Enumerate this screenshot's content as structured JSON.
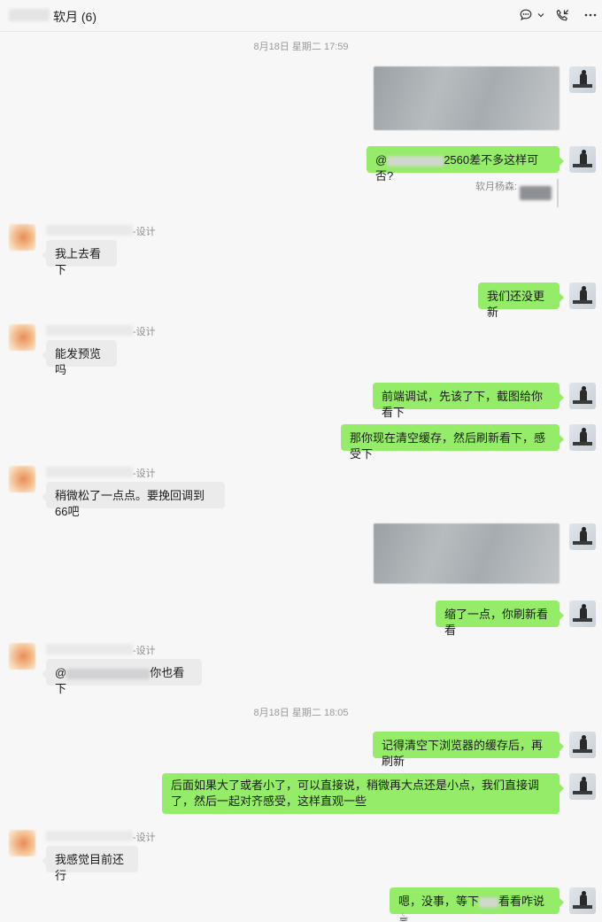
{
  "window": {
    "title": "软月 (6)"
  },
  "timestamps": [
    "8月18日 星期二 17:59",
    "8月18日 星期二 18:05"
  ],
  "sender_suffix": "-设计",
  "quote_label": "软月杨森:",
  "messages": {
    "m2": {
      "prefix": "@",
      "text": "2560差不多这样可否?"
    },
    "m3": {
      "text": "我上去看下"
    },
    "m4": {
      "text": "我们还没更新"
    },
    "m5": {
      "text": "能发预览吗"
    },
    "m6": {
      "text": "前端调试，先该了下，截图给你看下"
    },
    "m7": {
      "text": "那你现在清空缓存，然后刷新看下，感受下"
    },
    "m8": {
      "text": "稍微松了一点点。要挽回调到66吧"
    },
    "m10": {
      "text": "缩了一点，你刷新看看"
    },
    "m11": {
      "prefix": "@",
      "text": "你也看下"
    },
    "m12": {
      "text": "记得清空下浏览器的缓存后，再刷新"
    },
    "m13": {
      "text": "后面如果大了或者小了，可以直接说，稍微再大点还是小点，我们直接调了，然后一起对齐感受，这样直观一些"
    },
    "m14": {
      "text": "我感觉目前还行"
    },
    "m15": {
      "text_a": "嗯，没事，等下",
      "text_b": "看看咋说",
      "emoji": "☕"
    }
  },
  "icons": {
    "chat": "chat-bubble-icon",
    "dropdown": "chevron-down-icon",
    "call": "phone-call-icon",
    "more": "more-dots-icon"
  },
  "colors": {
    "my_bubble": "#95ec69",
    "other_bubble": "#ebebec",
    "background": "#f7f7f7"
  }
}
